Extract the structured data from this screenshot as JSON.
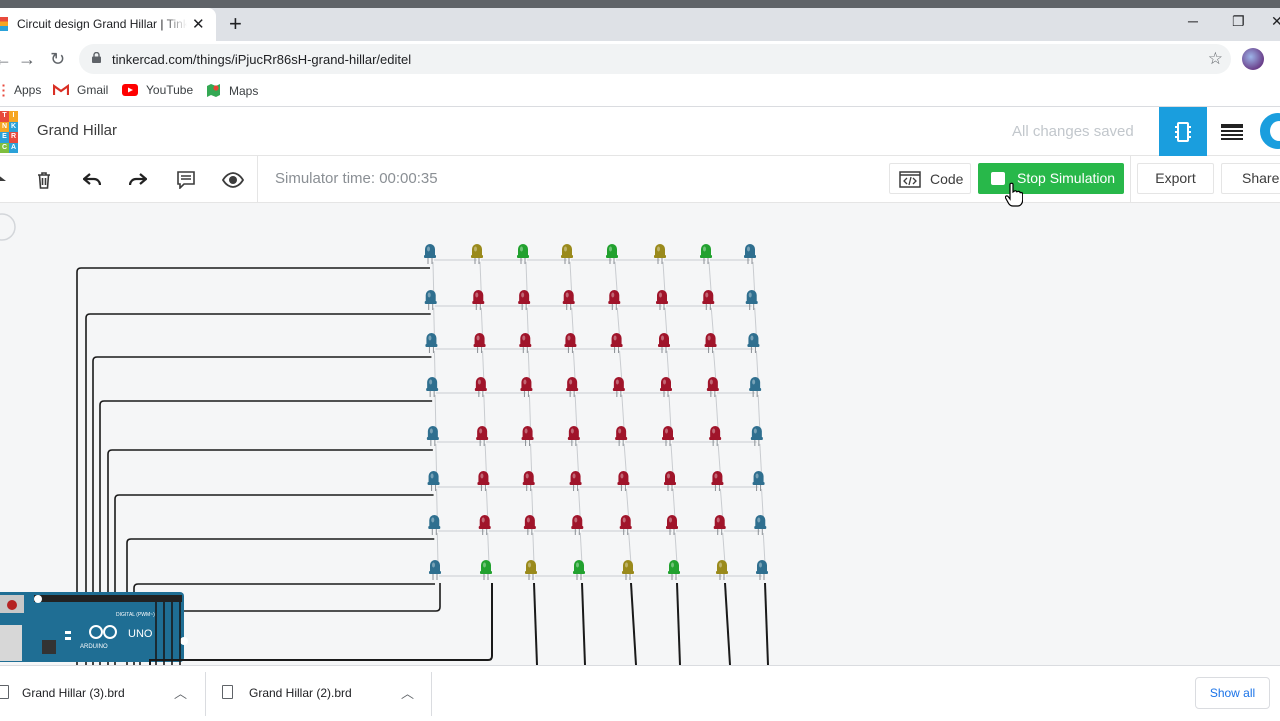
{
  "browser": {
    "tab_title": "Circuit design Grand Hillar | Tinkercad",
    "new_tab_icon": "plus-icon",
    "url": "tinkercad.com/things/iPjucRr86sH-grand-hillar/editel",
    "bookmarks": [
      {
        "label": "Apps",
        "icon": "apps-grid-icon"
      },
      {
        "label": "Gmail",
        "icon": "gmail-icon"
      },
      {
        "label": "YouTube",
        "icon": "youtube-icon"
      },
      {
        "label": "Maps",
        "icon": "maps-icon"
      }
    ]
  },
  "header": {
    "logo_letters": [
      "T",
      "I",
      "N",
      "K",
      "E",
      "R",
      "C",
      "A",
      "D"
    ],
    "project_name": "Grand Hillar",
    "save_status": "All changes saved"
  },
  "toolbar": {
    "simulator_time": "Simulator time: 00:00:35",
    "code_label": "Code",
    "stop_label": "Stop Simulation",
    "export_label": "Export",
    "share_label": "Share"
  },
  "canvas": {
    "led_grid": {
      "rows": 8,
      "cols": 8,
      "colors": {
        "blue": "#2f6f8f",
        "red": "#a0142a",
        "green": "#22a12f",
        "olive": "#9a8a1c"
      },
      "rows_colors": [
        [
          "blue",
          "olive",
          "green",
          "olive",
          "green",
          "olive",
          "green",
          "blue"
        ],
        [
          "blue",
          "red",
          "red",
          "red",
          "red",
          "red",
          "red",
          "blue"
        ],
        [
          "blue",
          "red",
          "red",
          "red",
          "red",
          "red",
          "red",
          "blue"
        ],
        [
          "blue",
          "red",
          "red",
          "red",
          "red",
          "red",
          "red",
          "blue"
        ],
        [
          "blue",
          "red",
          "red",
          "red",
          "red",
          "red",
          "red",
          "blue"
        ],
        [
          "blue",
          "red",
          "red",
          "red",
          "red",
          "red",
          "red",
          "blue"
        ],
        [
          "blue",
          "red",
          "red",
          "red",
          "red",
          "red",
          "red",
          "blue"
        ],
        [
          "blue",
          "green",
          "olive",
          "green",
          "olive",
          "green",
          "olive",
          "blue"
        ]
      ]
    },
    "arduino": {
      "brand": "ARDUINO",
      "model": "UNO",
      "header_label": "DIGITAL (PWM~)"
    }
  },
  "downloads": {
    "items": [
      {
        "name": "Grand Hillar (3).brd"
      },
      {
        "name": "Grand Hillar (2).brd"
      }
    ],
    "show_all_label": "Show all"
  },
  "colors": {
    "accent": "#1a9ede",
    "stop_green": "#28b84a"
  }
}
